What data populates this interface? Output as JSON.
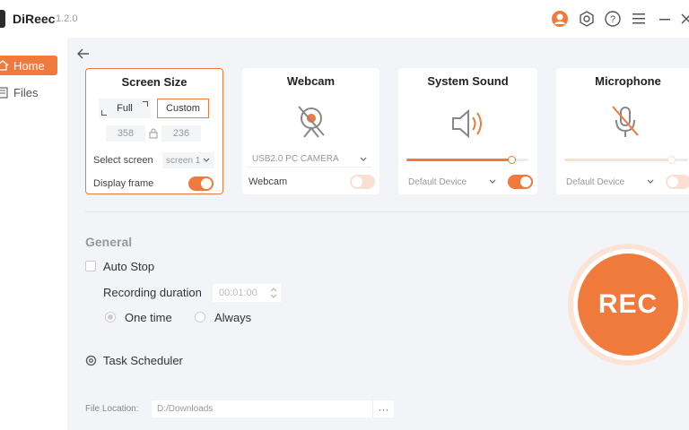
{
  "app": {
    "name": "DiReec",
    "version": "1.2.0"
  },
  "titlebar": {
    "icons": [
      "user-icon",
      "gear-icon",
      "help-icon",
      "menu-icon",
      "minimize-icon",
      "close-icon"
    ]
  },
  "sidebar": {
    "items": [
      {
        "label": "Home",
        "icon": "home-icon",
        "active": true
      },
      {
        "label": "Files",
        "icon": "files-icon",
        "active": false
      }
    ]
  },
  "screen": {
    "title": "Screen Size",
    "full_label": "Full",
    "custom_label": "Custom",
    "width": "358",
    "height": "236",
    "select_label": "Select screen",
    "select_value": "screen 1",
    "display_frame_label": "Display frame",
    "display_frame_on": true
  },
  "webcam": {
    "title": "Webcam",
    "device": "USB2.0 PC CAMERA",
    "toggle_label": "Webcam",
    "toggle_on": false
  },
  "sound": {
    "title": "System Sound",
    "device": "Default Device",
    "volume": 0.86,
    "toggle_on": true
  },
  "mic": {
    "title": "Microphone",
    "device": "Default Device",
    "volume": 0.86,
    "toggle_on": false
  },
  "general": {
    "title": "General",
    "auto_stop_label": "Auto Stop",
    "recording_duration_label": "Recording duration",
    "duration_value": "00:01:00",
    "one_time_label": "One time",
    "always_label": "Always",
    "task_scheduler_label": "Task Scheduler"
  },
  "file": {
    "label": "File Location:",
    "path": "D:/Downloads",
    "more": "···"
  },
  "rec": {
    "label": "REC"
  },
  "colors": {
    "accent": "#f07a3c",
    "accent_light": "#fde3d6"
  }
}
